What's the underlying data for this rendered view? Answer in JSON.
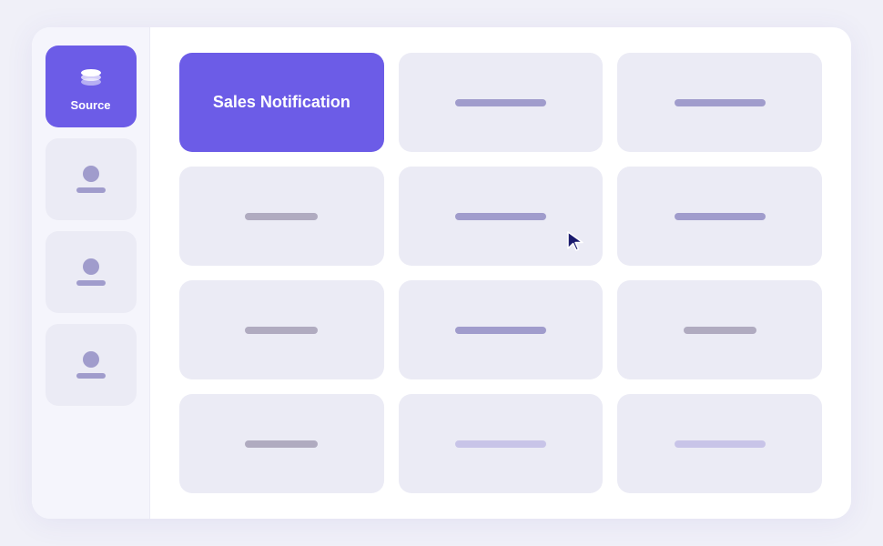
{
  "sidebar": {
    "items": [
      {
        "id": "source",
        "label": "Source",
        "active": true
      },
      {
        "id": "user1",
        "label": "",
        "active": false
      },
      {
        "id": "user2",
        "label": "",
        "active": false
      },
      {
        "id": "user3",
        "label": "",
        "active": false
      }
    ]
  },
  "grid": {
    "featured_card": {
      "label": "Sales Notification"
    },
    "colors": {
      "active_bg": "#6c5ce7",
      "inactive_bg": "#ebebf5",
      "bar_color": "#a09ccc"
    }
  }
}
